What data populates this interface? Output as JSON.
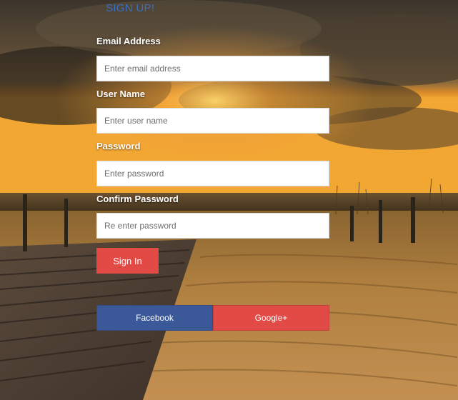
{
  "header": {
    "title": "SIGN UP!"
  },
  "form": {
    "email": {
      "label": "Email Address",
      "placeholder": "Enter email address",
      "value": ""
    },
    "username": {
      "label": "User Name",
      "placeholder": "Enter user name",
      "value": ""
    },
    "password": {
      "label": "Password",
      "placeholder": "Enter password",
      "value": ""
    },
    "confirm_password": {
      "label": "Confirm Password",
      "placeholder": "Re enter password",
      "value": ""
    },
    "submit_label": "Sign In"
  },
  "social": {
    "facebook_label": "Facebook",
    "google_label": "Google+"
  },
  "colors": {
    "title": "#3a6fc4",
    "signin_button": "#e24a45",
    "facebook_button": "#3b5998",
    "google_button": "#e24a45"
  }
}
